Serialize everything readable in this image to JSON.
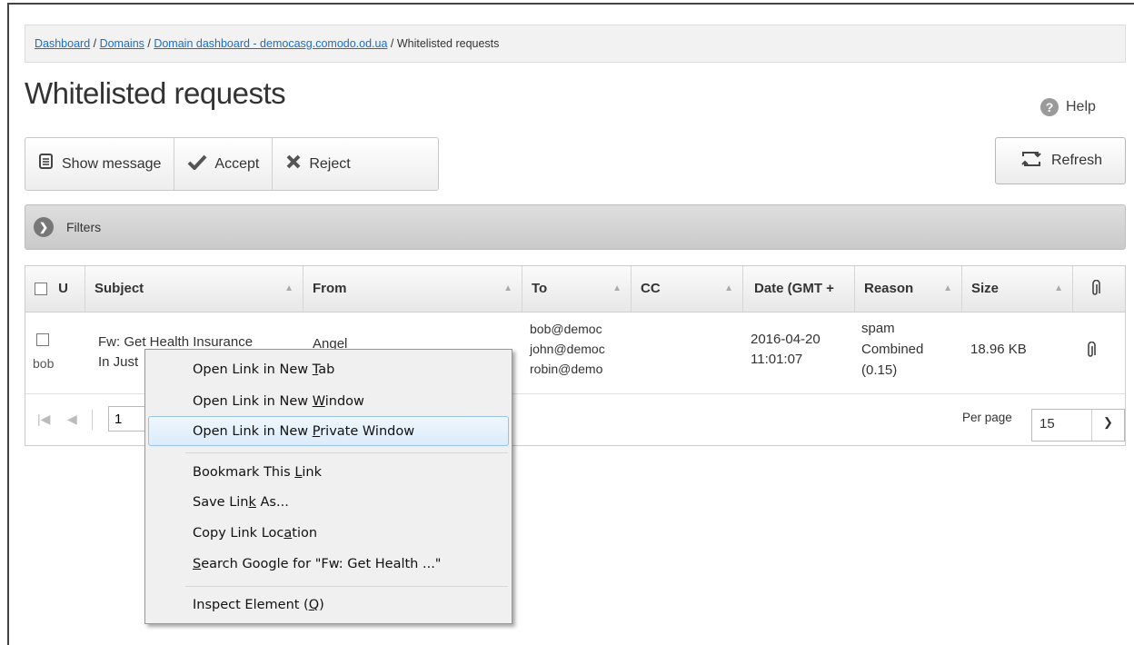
{
  "breadcrumb": {
    "dashboard": "Dashboard",
    "sep1": " / ",
    "domains": "Domains",
    "sep2": " / ",
    "domain_dashboard": "Domain dashboard - democasg.comodo.od.ua",
    "sep3": " / ",
    "current": "Whitelisted requests"
  },
  "page_title": "Whitelisted requests",
  "help_label": "Help",
  "toolbar": {
    "show_message": "Show message",
    "accept": "Accept",
    "reject": "Reject",
    "refresh": "Refresh"
  },
  "filters_label": "Filters",
  "table": {
    "columns": {
      "u": "U",
      "subject": "Subject",
      "from": "From",
      "to": "To",
      "cc": "CC",
      "date": "Date (GMT +",
      "reason": "Reason",
      "size": "Size"
    },
    "row": {
      "user": "bob",
      "subject_line1": "Fw: Get Health Insurance",
      "subject_line2": "In Just",
      "from": "Angel",
      "to1": "bob@democ",
      "to2": "john@democ",
      "to3": "robin@demo",
      "date1": "2016-04-20",
      "date2": "11:01:07",
      "reason1": "spam",
      "reason2": "Combined",
      "reason3": "(0.15)",
      "size": "18.96 KB"
    }
  },
  "pager": {
    "page": "1",
    "per_page_label": "Per page",
    "per_page_value": "15"
  },
  "context_menu": {
    "items": [
      {
        "pre": "Open Link in New ",
        "key": "T",
        "post": "ab"
      },
      {
        "pre": "Open Link in New ",
        "key": "W",
        "post": "indow"
      },
      {
        "pre": "Open Link in New ",
        "key": "P",
        "post": "rivate Window"
      },
      {
        "pre": "Bookmark This ",
        "key": "L",
        "post": "ink"
      },
      {
        "pre": "Save Lin",
        "key": "k",
        "post": " As..."
      },
      {
        "pre": "Copy Link Loc",
        "key": "a",
        "post": "tion"
      },
      {
        "pre": "",
        "key": "S",
        "post": "earch Google for \"Fw: Get Health ...\""
      },
      {
        "pre": "Inspect Element (",
        "key": "Q",
        "post": ")"
      }
    ]
  },
  "colors": {
    "link": "#1a6fc4",
    "menu_highlight": "#dcecfa",
    "filters_bar": "#d2d2d2"
  }
}
